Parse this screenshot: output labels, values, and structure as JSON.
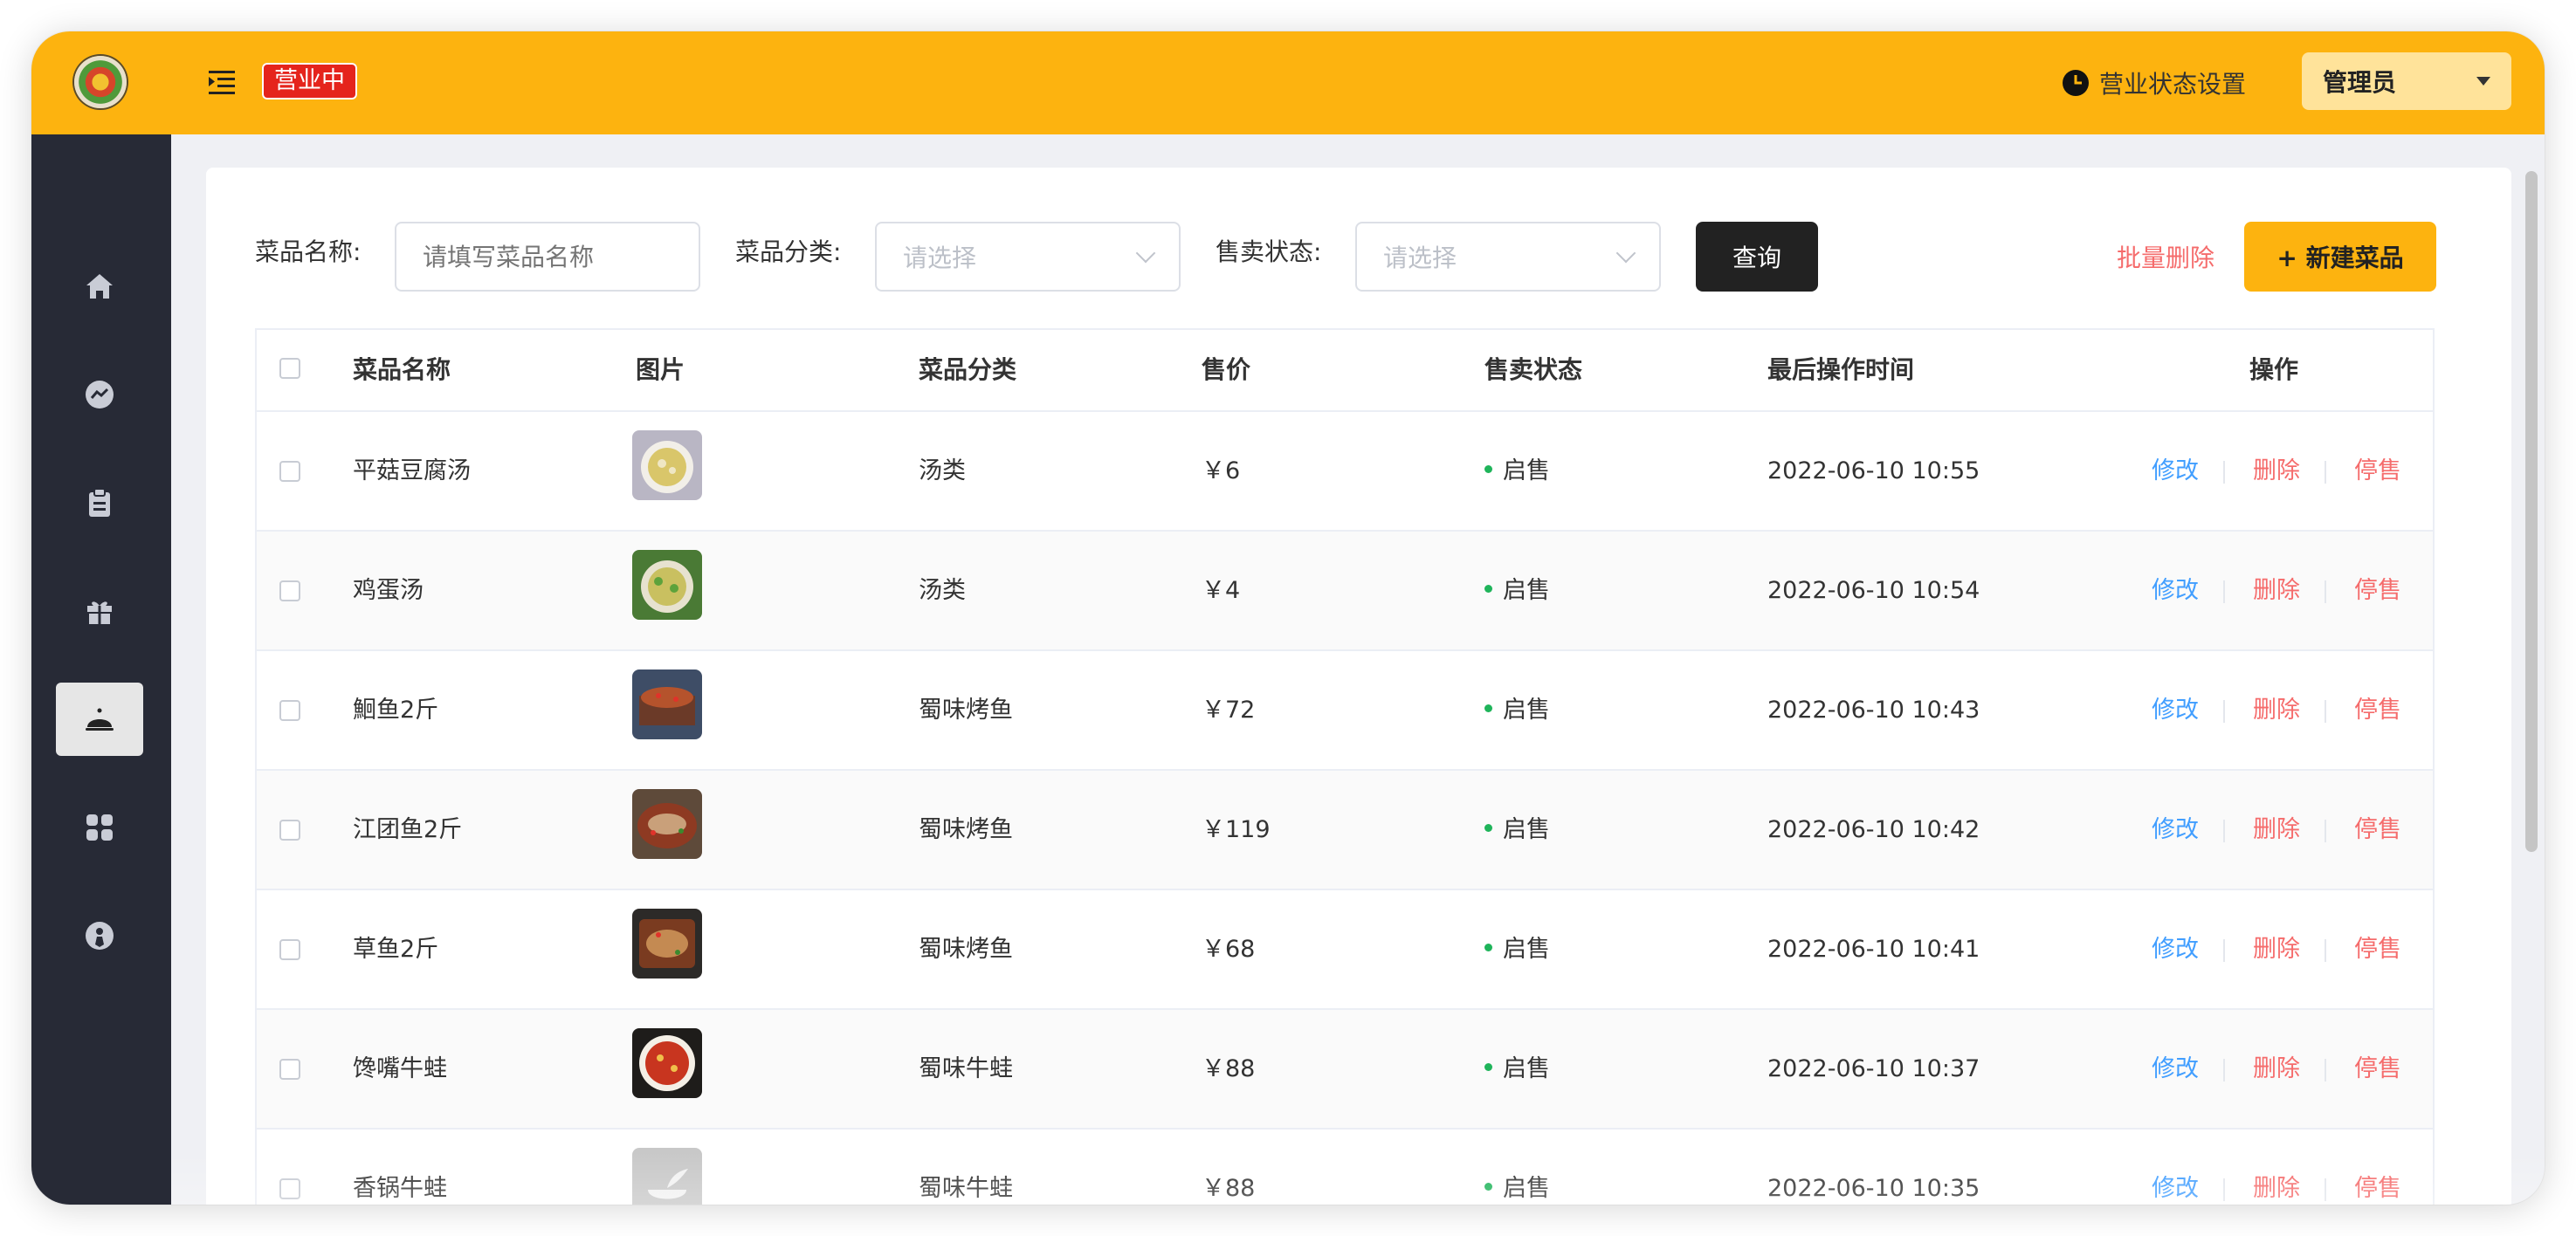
{
  "header": {
    "status_tag": "营业中",
    "biz_setting": "营业状态设置",
    "admin": "管理员"
  },
  "sidebar": {
    "items": [
      {
        "icon": "home-icon"
      },
      {
        "icon": "chart-icon"
      },
      {
        "icon": "clipboard-icon"
      },
      {
        "icon": "gift-icon"
      },
      {
        "icon": "cloche-icon",
        "active": true
      },
      {
        "icon": "grid-icon"
      },
      {
        "icon": "user-icon"
      }
    ]
  },
  "filters": {
    "name_label": "菜品名称:",
    "name_placeholder": "请填写菜品名称",
    "category_label": "菜品分类:",
    "category_placeholder": "请选择",
    "status_label": "售卖状态:",
    "status_placeholder": "请选择",
    "query": "查询",
    "batch_delete": "批量删除",
    "new_dish": "+ 新建菜品"
  },
  "table": {
    "columns": [
      "菜品名称",
      "图片",
      "菜品分类",
      "售价",
      "售卖状态",
      "最后操作时间",
      "操作"
    ],
    "actions": {
      "edit": "修改",
      "delete": "删除",
      "stop": "停售"
    },
    "rows": [
      {
        "name": "平菇豆腐汤",
        "category": "汤类",
        "price": "￥6",
        "status": "启售",
        "time": "2022-06-10 10:55"
      },
      {
        "name": "鸡蛋汤",
        "category": "汤类",
        "price": "￥4",
        "status": "启售",
        "time": "2022-06-10 10:54"
      },
      {
        "name": "鮰鱼2斤",
        "category": "蜀味烤鱼",
        "price": "￥72",
        "status": "启售",
        "time": "2022-06-10 10:43"
      },
      {
        "name": "江团鱼2斤",
        "category": "蜀味烤鱼",
        "price": "￥119",
        "status": "启售",
        "time": "2022-06-10 10:42"
      },
      {
        "name": "草鱼2斤",
        "category": "蜀味烤鱼",
        "price": "￥68",
        "status": "启售",
        "time": "2022-06-10 10:41"
      },
      {
        "name": "馋嘴牛蛙",
        "category": "蜀味牛蛙",
        "price": "￥88",
        "status": "启售",
        "time": "2022-06-10 10:37"
      },
      {
        "name": "香锅牛蛙",
        "category": "蜀味牛蛙",
        "price": "￥88",
        "status": "启售",
        "time": "2022-06-10 10:35"
      }
    ]
  },
  "colors": {
    "brand": "#fdb30f",
    "sidebar": "#272a36",
    "status_on": "#1fb45a",
    "link": "#419eff",
    "danger": "#f56c6c"
  }
}
